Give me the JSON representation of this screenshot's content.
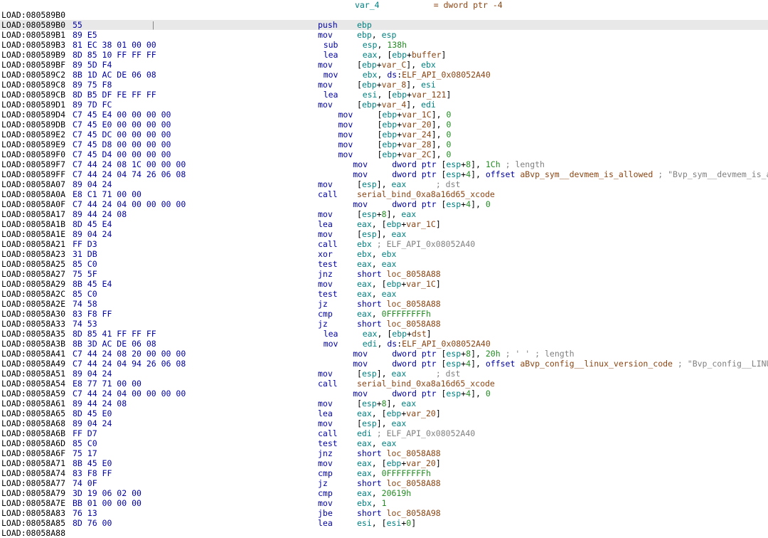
{
  "header": {
    "addr": "",
    "bytes": "",
    "sep": "",
    "mid_html": "                                        <span class='t-teal'>var_4</span>           <span class='t-brown'>= dword ptr -4</span>",
    "mn": "",
    "ops_html": ""
  },
  "rows": [
    {
      "addr": "LOAD:080589B0",
      "bytes": "",
      "sel": false,
      "mn": "",
      "ops_html": ""
    },
    {
      "addr": "LOAD:080589B0",
      "bytes": "55",
      "sel": true,
      "sep": "|",
      "mn": "push",
      "ops_html": "<span class='t-teal'>ebp</span>"
    },
    {
      "addr": "LOAD:080589B1",
      "bytes": "89 E5",
      "mn": "mov",
      "ops_html": "<span class='t-teal'>ebp</span>, <span class='t-teal'>esp</span>"
    },
    {
      "addr": "LOAD:080589B3",
      "bytes": "81 EC 38 01 00 00",
      "mn": "sub",
      "ops_html": "<span class='t-teal'>esp</span>, <span class='t-green'>138h</span>"
    },
    {
      "addr": "LOAD:080589B9",
      "bytes": "8D 85 10 FF FF FF",
      "mn": "lea",
      "ops_html": "<span class='t-teal'>eax</span>, [<span class='t-teal'>ebp</span>+<span class='t-brown'>buffer</span>]"
    },
    {
      "addr": "LOAD:080589BF",
      "bytes": "89 5D F4",
      "mn": "mov",
      "ops_html": "[<span class='t-teal'>ebp</span>+<span class='t-brown'>var_C</span>], <span class='t-teal'>ebx</span>"
    },
    {
      "addr": "LOAD:080589C2",
      "bytes": "8B 1D AC DE 06 08",
      "mn": "mov",
      "ops_html": "<span class='t-teal'>ebx</span>, <span class='t-blue'>ds</span>:<span class='t-brown'>ELF_API_0x08052A40</span>"
    },
    {
      "addr": "LOAD:080589C8",
      "bytes": "89 75 F8",
      "mn": "mov",
      "ops_html": "[<span class='t-teal'>ebp</span>+<span class='t-brown'>var_8</span>], <span class='t-teal'>esi</span>"
    },
    {
      "addr": "LOAD:080589CB",
      "bytes": "8D B5 DF FE FF FF",
      "mn": "lea",
      "ops_html": "<span class='t-teal'>esi</span>, [<span class='t-teal'>ebp</span>+<span class='t-brown'>var_121</span>]"
    },
    {
      "addr": "LOAD:080589D1",
      "bytes": "89 7D FC",
      "mn": "mov",
      "ops_html": "[<span class='t-teal'>ebp</span>+<span class='t-brown'>var_4</span>], <span class='t-teal'>edi</span>"
    },
    {
      "addr": "LOAD:080589D4",
      "bytes": "C7 45 E4 00 00 00 00",
      "mn": "mov",
      "ops_html": "[<span class='t-teal'>ebp</span>+<span class='t-brown'>var_1C</span>], <span class='t-green'>0</span>"
    },
    {
      "addr": "LOAD:080589DB",
      "bytes": "C7 45 E0 00 00 00 00",
      "mn": "mov",
      "ops_html": "[<span class='t-teal'>ebp</span>+<span class='t-brown'>var_20</span>], <span class='t-green'>0</span>"
    },
    {
      "addr": "LOAD:080589E2",
      "bytes": "C7 45 DC 00 00 00 00",
      "mn": "mov",
      "ops_html": "[<span class='t-teal'>ebp</span>+<span class='t-brown'>var_24</span>], <span class='t-green'>0</span>"
    },
    {
      "addr": "LOAD:080589E9",
      "bytes": "C7 45 D8 00 00 00 00",
      "mn": "mov",
      "ops_html": "[<span class='t-teal'>ebp</span>+<span class='t-brown'>var_28</span>], <span class='t-green'>0</span>"
    },
    {
      "addr": "LOAD:080589F0",
      "bytes": "C7 45 D4 00 00 00 00",
      "mn": "mov",
      "ops_html": "[<span class='t-teal'>ebp</span>+<span class='t-brown'>var_2C</span>], <span class='t-green'>0</span>"
    },
    {
      "addr": "LOAD:080589F7",
      "bytes": "C7 44 24 08 1C 00 00 00",
      "mn": "mov",
      "ops_html": "<span class='t-blue'>dword ptr</span> [<span class='t-teal'>esp</span>+<span class='t-green'>8</span>], <span class='t-green'>1Ch</span> <span class='t-gray'>; length</span>"
    },
    {
      "addr": "LOAD:080589FF",
      "bytes": "C7 44 24 04 74 26 06 08",
      "mn": "mov",
      "ops_html": "<span class='t-blue'>dword ptr</span> [<span class='t-teal'>esp</span>+<span class='t-green'>4</span>], <span class='t-blue'>offset</span> <span class='t-brown'>aBvp_sym__devmem_is_allowed</span> <span class='t-gray'>; \"Bvp_sym__devmem_is_allowed\"</span>"
    },
    {
      "addr": "LOAD:08058A07",
      "bytes": "89 04 24",
      "mn": "mov",
      "ops_html": "[<span class='t-teal'>esp</span>], <span class='t-teal'>eax</span>      <span class='t-gray'>; dst</span>"
    },
    {
      "addr": "LOAD:08058A0A",
      "bytes": "E8 C1 71 00 00",
      "mn": "call",
      "ops_html": "<span class='t-brown'>serial_bind_0xa8a16d65_xcode</span>"
    },
    {
      "addr": "LOAD:08058A0F",
      "bytes": "C7 44 24 04 00 00 00 00",
      "mn": "mov",
      "ops_html": "<span class='t-blue'>dword ptr</span> [<span class='t-teal'>esp</span>+<span class='t-green'>4</span>], <span class='t-green'>0</span>"
    },
    {
      "addr": "LOAD:08058A17",
      "bytes": "89 44 24 08",
      "mn": "mov",
      "ops_html": "[<span class='t-teal'>esp</span>+<span class='t-green'>8</span>], <span class='t-teal'>eax</span>"
    },
    {
      "addr": "LOAD:08058A1B",
      "bytes": "8D 45 E4",
      "mn": "lea",
      "ops_html": "<span class='t-teal'>eax</span>, [<span class='t-teal'>ebp</span>+<span class='t-brown'>var_1C</span>]"
    },
    {
      "addr": "LOAD:08058A1E",
      "bytes": "89 04 24",
      "mn": "mov",
      "ops_html": "[<span class='t-teal'>esp</span>], <span class='t-teal'>eax</span>"
    },
    {
      "addr": "LOAD:08058A21",
      "bytes": "FF D3",
      "mn": "call",
      "ops_html": "<span class='t-teal'>ebx</span> <span class='t-gray'>; ELF_API_0x08052A40</span>"
    },
    {
      "addr": "LOAD:08058A23",
      "bytes": "31 DB",
      "mn": "xor",
      "ops_html": "<span class='t-teal'>ebx</span>, <span class='t-teal'>ebx</span>"
    },
    {
      "addr": "LOAD:08058A25",
      "bytes": "85 C0",
      "mn": "test",
      "ops_html": "<span class='t-teal'>eax</span>, <span class='t-teal'>eax</span>"
    },
    {
      "addr": "LOAD:08058A27",
      "bytes": "75 5F",
      "mn": "jnz",
      "ops_html": "<span class='t-blue'>short</span> <span class='t-brown'>loc_8058A88</span>"
    },
    {
      "addr": "LOAD:08058A29",
      "bytes": "8B 45 E4",
      "mn": "mov",
      "ops_html": "<span class='t-teal'>eax</span>, [<span class='t-teal'>ebp</span>+<span class='t-brown'>var_1C</span>]"
    },
    {
      "addr": "LOAD:08058A2C",
      "bytes": "85 C0",
      "mn": "test",
      "ops_html": "<span class='t-teal'>eax</span>, <span class='t-teal'>eax</span>"
    },
    {
      "addr": "LOAD:08058A2E",
      "bytes": "74 58",
      "mn": "jz",
      "ops_html": "<span class='t-blue'>short</span> <span class='t-brown'>loc_8058A88</span>"
    },
    {
      "addr": "LOAD:08058A30",
      "bytes": "83 F8 FF",
      "mn": "cmp",
      "ops_html": "<span class='t-teal'>eax</span>, <span class='t-green'>0FFFFFFFFh</span>"
    },
    {
      "addr": "LOAD:08058A33",
      "bytes": "74 53",
      "mn": "jz",
      "ops_html": "<span class='t-blue'>short</span> <span class='t-brown'>loc_8058A88</span>"
    },
    {
      "addr": "LOAD:08058A35",
      "bytes": "8D 85 41 FF FF FF",
      "mn": "lea",
      "ops_html": "<span class='t-teal'>eax</span>, [<span class='t-teal'>ebp</span>+<span class='t-brown'>dst</span>]"
    },
    {
      "addr": "LOAD:08058A3B",
      "bytes": "8B 3D AC DE 06 08",
      "mn": "mov",
      "ops_html": "<span class='t-teal'>edi</span>, <span class='t-blue'>ds</span>:<span class='t-brown'>ELF_API_0x08052A40</span>"
    },
    {
      "addr": "LOAD:08058A41",
      "bytes": "C7 44 24 08 20 00 00 00",
      "mn": "mov",
      "ops_html": "<span class='t-blue'>dword ptr</span> [<span class='t-teal'>esp</span>+<span class='t-green'>8</span>], <span class='t-green'>20h</span> <span class='t-gray'>; ' ' ; length</span>"
    },
    {
      "addr": "LOAD:08058A49",
      "bytes": "C7 44 24 04 94 26 06 08",
      "mn": "mov",
      "ops_html": "<span class='t-blue'>dword ptr</span> [<span class='t-teal'>esp</span>+<span class='t-green'>4</span>], <span class='t-blue'>offset</span> <span class='t-brown'>aBvp_config__linux_version_code</span> <span class='t-gray'>; \"Bvp_config__LINUX_VERSION_CODE\"</span>"
    },
    {
      "addr": "LOAD:08058A51",
      "bytes": "89 04 24",
      "mn": "mov",
      "ops_html": "[<span class='t-teal'>esp</span>], <span class='t-teal'>eax</span>      <span class='t-gray'>; dst</span>"
    },
    {
      "addr": "LOAD:08058A54",
      "bytes": "E8 77 71 00 00",
      "mn": "call",
      "ops_html": "<span class='t-brown'>serial_bind_0xa8a16d65_xcode</span>"
    },
    {
      "addr": "LOAD:08058A59",
      "bytes": "C7 44 24 04 00 00 00 00",
      "mn": "mov",
      "ops_html": "<span class='t-blue'>dword ptr</span> [<span class='t-teal'>esp</span>+<span class='t-green'>4</span>], <span class='t-green'>0</span>"
    },
    {
      "addr": "LOAD:08058A61",
      "bytes": "89 44 24 08",
      "mn": "mov",
      "ops_html": "[<span class='t-teal'>esp</span>+<span class='t-green'>8</span>], <span class='t-teal'>eax</span>"
    },
    {
      "addr": "LOAD:08058A65",
      "bytes": "8D 45 E0",
      "mn": "lea",
      "ops_html": "<span class='t-teal'>eax</span>, [<span class='t-teal'>ebp</span>+<span class='t-brown'>var_20</span>]"
    },
    {
      "addr": "LOAD:08058A68",
      "bytes": "89 04 24",
      "mn": "mov",
      "ops_html": "[<span class='t-teal'>esp</span>], <span class='t-teal'>eax</span>"
    },
    {
      "addr": "LOAD:08058A6B",
      "bytes": "FF D7",
      "mn": "call",
      "ops_html": "<span class='t-teal'>edi</span> <span class='t-gray'>; ELF_API_0x08052A40</span>"
    },
    {
      "addr": "LOAD:08058A6D",
      "bytes": "85 C0",
      "mn": "test",
      "ops_html": "<span class='t-teal'>eax</span>, <span class='t-teal'>eax</span>"
    },
    {
      "addr": "LOAD:08058A6F",
      "bytes": "75 17",
      "mn": "jnz",
      "ops_html": "<span class='t-blue'>short</span> <span class='t-brown'>loc_8058A88</span>"
    },
    {
      "addr": "LOAD:08058A71",
      "bytes": "8B 45 E0",
      "mn": "mov",
      "ops_html": "<span class='t-teal'>eax</span>, [<span class='t-teal'>ebp</span>+<span class='t-brown'>var_20</span>]"
    },
    {
      "addr": "LOAD:08058A74",
      "bytes": "83 F8 FF",
      "mn": "cmp",
      "ops_html": "<span class='t-teal'>eax</span>, <span class='t-green'>0FFFFFFFFh</span>"
    },
    {
      "addr": "LOAD:08058A77",
      "bytes": "74 0F",
      "mn": "jz",
      "ops_html": "<span class='t-blue'>short</span> <span class='t-brown'>loc_8058A88</span>"
    },
    {
      "addr": "LOAD:08058A79",
      "bytes": "3D 19 06 02 00",
      "mn": "cmp",
      "ops_html": "<span class='t-teal'>eax</span>, <span class='t-green'>20619h</span>"
    },
    {
      "addr": "LOAD:08058A7E",
      "bytes": "BB 01 00 00 00",
      "mn": "mov",
      "ops_html": "<span class='t-teal'>ebx</span>, <span class='t-green'>1</span>"
    },
    {
      "addr": "LOAD:08058A83",
      "bytes": "76 13",
      "mn": "jbe",
      "ops_html": "<span class='t-blue'>short</span> <span class='t-brown'>loc_8058A98</span>"
    },
    {
      "addr": "LOAD:08058A85",
      "bytes": "8D 76 00",
      "mn": "lea",
      "ops_html": "<span class='t-teal'>esi</span>, [<span class='t-teal'>esi</span>+<span class='t-green'>0</span>]"
    },
    {
      "addr": "LOAD:08058A88",
      "bytes": "",
      "mn": "",
      "ops_html": ""
    }
  ]
}
